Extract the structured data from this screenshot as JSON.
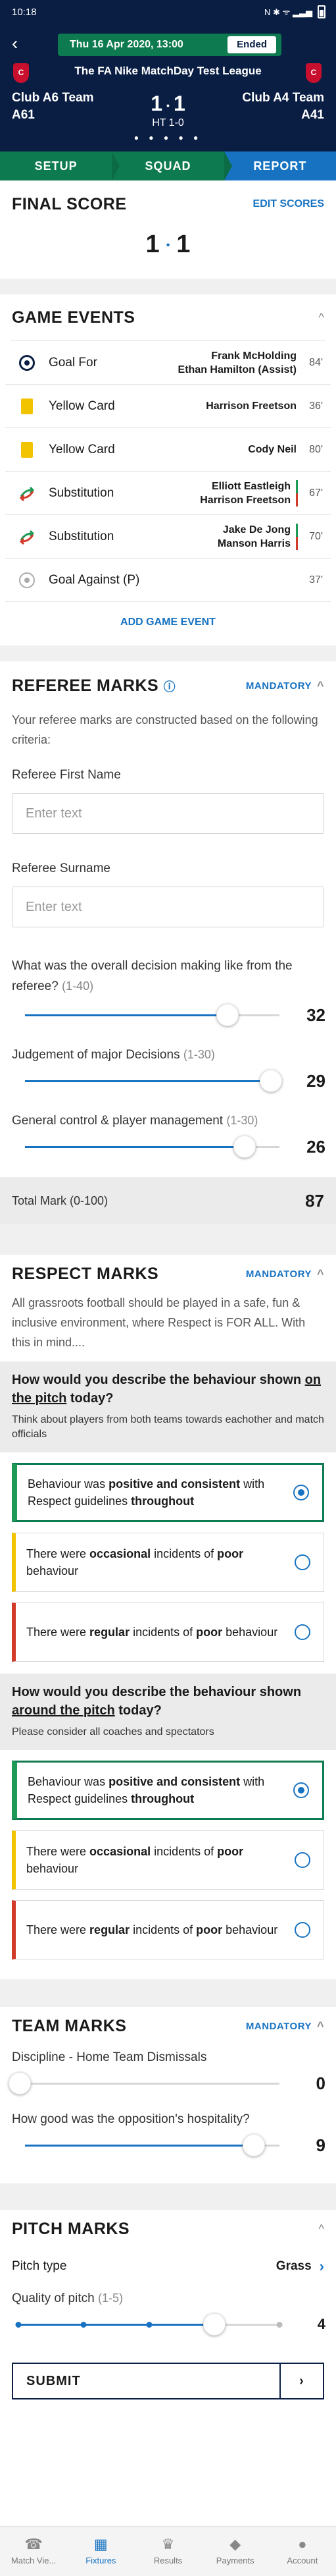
{
  "status_bar": {
    "time": "10:18",
    "right_icons": "N ✱ ᯤ ▂▃▅"
  },
  "match": {
    "date": "Thu 16 Apr 2020, 13:00",
    "state": "Ended",
    "league": "The FA Nike MatchDay Test League",
    "home_team": "Club A6 Team",
    "home_code": "A61",
    "away_team": "Club A4 Team",
    "away_code": "A41",
    "home_score": "1",
    "away_score": "1",
    "half_time": "HT 1-0",
    "pager_dots": "● ● ● ● ●",
    "crest_letter": "C"
  },
  "steps": [
    "SETUP",
    "SQUAD",
    "REPORT"
  ],
  "final_score": {
    "title": "FINAL SCORE",
    "edit_label": "EDIT SCORES",
    "home": "1",
    "away": "1",
    "separator": "•"
  },
  "game_events": {
    "title": "GAME EVENTS",
    "collapse_icon": "^",
    "items": [
      {
        "type": "Goal For",
        "players": [
          "Frank McHolding",
          "Ethan Hamilton (Assist)"
        ],
        "minute": "84'",
        "icon": "goal-icon"
      },
      {
        "type": "Yellow Card",
        "players": [
          "Harrison Freetson"
        ],
        "minute": "36'",
        "icon": "yellow-card-icon"
      },
      {
        "type": "Yellow Card",
        "players": [
          "Cody Neil"
        ],
        "minute": "80'",
        "icon": "yellow-card-icon"
      },
      {
        "type": "Substitution",
        "players": [
          "Elliott Eastleigh",
          "Harrison Freetson"
        ],
        "minute": "67'",
        "icon": "substitution-icon"
      },
      {
        "type": "Substitution",
        "players": [
          "Jake De Jong",
          "Manson Harris"
        ],
        "minute": "70'",
        "icon": "substitution-icon"
      },
      {
        "type": "Goal Against (P)",
        "players": [],
        "minute": "37'",
        "icon": "goal-against-icon"
      }
    ],
    "add_label": "ADD GAME EVENT"
  },
  "referee_marks": {
    "title": "REFEREE MARKS",
    "info_icon": "ⓘ",
    "mandatory": "MANDATORY",
    "intro": "Your referee marks are constructed based on the following criteria:",
    "first_name_label": "Referee First Name",
    "first_name_placeholder": "Enter text",
    "surname_label": "Referee Surname",
    "surname_placeholder": "Enter text",
    "q1_text": "What was the overall decision making like from the referee?",
    "q1_range": "(1-40)",
    "q1_value": 32,
    "q1_min": 1,
    "q1_max": 40,
    "q2_text": "Judgement of major Decisions",
    "q2_range": "(1-30)",
    "q2_value": 29,
    "q2_min": 1,
    "q2_max": 30,
    "q3_text": "General control & player management",
    "q3_range": "(1-30)",
    "q3_value": 26,
    "q3_min": 1,
    "q3_max": 30,
    "total_label": "Total Mark (0-100)",
    "total_value": "87"
  },
  "respect_marks": {
    "title": "RESPECT MARKS",
    "mandatory": "MANDATORY",
    "intro": "All grassroots football should be played in a safe, fun & inclusive environment, where Respect is FOR ALL. With this in mind....",
    "pitch_question_before": "How would you describe the behaviour shown ",
    "pitch_question_emph": "on the pitch",
    "pitch_question_after": " today?",
    "pitch_hint": "Think about players from both teams towards eachother and match officials",
    "around_question_before": "How would you describe the behaviour shown ",
    "around_question_emph": "around the pitch",
    "around_question_after": " today?",
    "around_hint": "Please consider all coaches and spectators",
    "options": [
      {
        "pre": "Behaviour was ",
        "bold": "positive and consistent",
        "mid": " with Respect guidelines ",
        "bold2": "throughout",
        "tail": ""
      },
      {
        "pre": "There were ",
        "bold": "occasional",
        "mid": " incidents of ",
        "bold2": "poor",
        "tail": " behaviour"
      },
      {
        "pre": "There were ",
        "bold": "regular",
        "mid": " incidents of ",
        "bold2": "poor",
        "tail": " behaviour"
      }
    ],
    "selected_on_pitch": 0,
    "selected_around_pitch": 0
  },
  "team_marks": {
    "title": "TEAM MARKS",
    "mandatory": "MANDATORY",
    "discipline_label": "Discipline - Home Team Dismissals",
    "discipline_value": 0,
    "discipline_min": 0,
    "discipline_max": 10,
    "hospitality_label": "How good was the opposition's hospitality?",
    "hospitality_value": 9,
    "hospitality_min": 0,
    "hospitality_max": 10
  },
  "pitch_marks": {
    "title": "PITCH MARKS",
    "pitch_type_label": "Pitch type",
    "pitch_type_value": "Grass",
    "quality_label": "Quality of pitch",
    "quality_range": "(1-5)",
    "quality_value": 4,
    "quality_min": 1,
    "quality_max": 5
  },
  "submit_label": "SUBMIT",
  "tabs": [
    {
      "label": "Match Vie...",
      "icon": "whistle-icon",
      "glyph": "☎"
    },
    {
      "label": "Fixtures",
      "icon": "pitch-icon",
      "glyph": "▦"
    },
    {
      "label": "Results",
      "icon": "trophy-icon",
      "glyph": "♛"
    },
    {
      "label": "Payments",
      "icon": "wallet-icon",
      "glyph": "◆"
    },
    {
      "label": "Account",
      "icon": "person-icon",
      "glyph": "●"
    }
  ],
  "active_tab": 1,
  "colors": {
    "navy": "#0a1e44",
    "green": "#0d7a4f",
    "blue": "#1773c2",
    "card_yellow": "#f2c400",
    "respect_green": "#1f9a56",
    "respect_red": "#d23a2a"
  }
}
